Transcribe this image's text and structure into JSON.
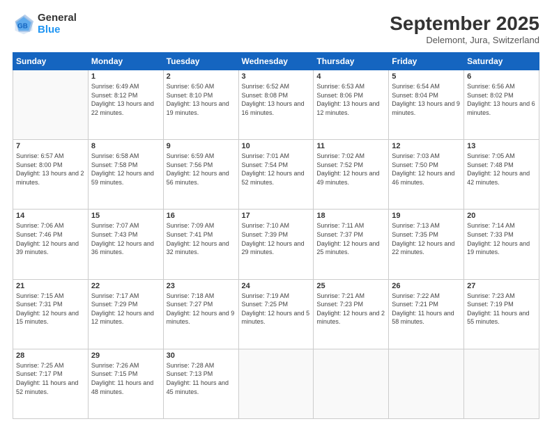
{
  "header": {
    "logo": {
      "general": "General",
      "blue": "Blue"
    },
    "title": "September 2025",
    "location": "Delemont, Jura, Switzerland"
  },
  "weekdays": [
    "Sunday",
    "Monday",
    "Tuesday",
    "Wednesday",
    "Thursday",
    "Friday",
    "Saturday"
  ],
  "weeks": [
    [
      {
        "day": "",
        "sunrise": "",
        "sunset": "",
        "daylight": ""
      },
      {
        "day": "1",
        "sunrise": "Sunrise: 6:49 AM",
        "sunset": "Sunset: 8:12 PM",
        "daylight": "Daylight: 13 hours and 22 minutes."
      },
      {
        "day": "2",
        "sunrise": "Sunrise: 6:50 AM",
        "sunset": "Sunset: 8:10 PM",
        "daylight": "Daylight: 13 hours and 19 minutes."
      },
      {
        "day": "3",
        "sunrise": "Sunrise: 6:52 AM",
        "sunset": "Sunset: 8:08 PM",
        "daylight": "Daylight: 13 hours and 16 minutes."
      },
      {
        "day": "4",
        "sunrise": "Sunrise: 6:53 AM",
        "sunset": "Sunset: 8:06 PM",
        "daylight": "Daylight: 13 hours and 12 minutes."
      },
      {
        "day": "5",
        "sunrise": "Sunrise: 6:54 AM",
        "sunset": "Sunset: 8:04 PM",
        "daylight": "Daylight: 13 hours and 9 minutes."
      },
      {
        "day": "6",
        "sunrise": "Sunrise: 6:56 AM",
        "sunset": "Sunset: 8:02 PM",
        "daylight": "Daylight: 13 hours and 6 minutes."
      }
    ],
    [
      {
        "day": "7",
        "sunrise": "Sunrise: 6:57 AM",
        "sunset": "Sunset: 8:00 PM",
        "daylight": "Daylight: 13 hours and 2 minutes."
      },
      {
        "day": "8",
        "sunrise": "Sunrise: 6:58 AM",
        "sunset": "Sunset: 7:58 PM",
        "daylight": "Daylight: 12 hours and 59 minutes."
      },
      {
        "day": "9",
        "sunrise": "Sunrise: 6:59 AM",
        "sunset": "Sunset: 7:56 PM",
        "daylight": "Daylight: 12 hours and 56 minutes."
      },
      {
        "day": "10",
        "sunrise": "Sunrise: 7:01 AM",
        "sunset": "Sunset: 7:54 PM",
        "daylight": "Daylight: 12 hours and 52 minutes."
      },
      {
        "day": "11",
        "sunrise": "Sunrise: 7:02 AM",
        "sunset": "Sunset: 7:52 PM",
        "daylight": "Daylight: 12 hours and 49 minutes."
      },
      {
        "day": "12",
        "sunrise": "Sunrise: 7:03 AM",
        "sunset": "Sunset: 7:50 PM",
        "daylight": "Daylight: 12 hours and 46 minutes."
      },
      {
        "day": "13",
        "sunrise": "Sunrise: 7:05 AM",
        "sunset": "Sunset: 7:48 PM",
        "daylight": "Daylight: 12 hours and 42 minutes."
      }
    ],
    [
      {
        "day": "14",
        "sunrise": "Sunrise: 7:06 AM",
        "sunset": "Sunset: 7:46 PM",
        "daylight": "Daylight: 12 hours and 39 minutes."
      },
      {
        "day": "15",
        "sunrise": "Sunrise: 7:07 AM",
        "sunset": "Sunset: 7:43 PM",
        "daylight": "Daylight: 12 hours and 36 minutes."
      },
      {
        "day": "16",
        "sunrise": "Sunrise: 7:09 AM",
        "sunset": "Sunset: 7:41 PM",
        "daylight": "Daylight: 12 hours and 32 minutes."
      },
      {
        "day": "17",
        "sunrise": "Sunrise: 7:10 AM",
        "sunset": "Sunset: 7:39 PM",
        "daylight": "Daylight: 12 hours and 29 minutes."
      },
      {
        "day": "18",
        "sunrise": "Sunrise: 7:11 AM",
        "sunset": "Sunset: 7:37 PM",
        "daylight": "Daylight: 12 hours and 25 minutes."
      },
      {
        "day": "19",
        "sunrise": "Sunrise: 7:13 AM",
        "sunset": "Sunset: 7:35 PM",
        "daylight": "Daylight: 12 hours and 22 minutes."
      },
      {
        "day": "20",
        "sunrise": "Sunrise: 7:14 AM",
        "sunset": "Sunset: 7:33 PM",
        "daylight": "Daylight: 12 hours and 19 minutes."
      }
    ],
    [
      {
        "day": "21",
        "sunrise": "Sunrise: 7:15 AM",
        "sunset": "Sunset: 7:31 PM",
        "daylight": "Daylight: 12 hours and 15 minutes."
      },
      {
        "day": "22",
        "sunrise": "Sunrise: 7:17 AM",
        "sunset": "Sunset: 7:29 PM",
        "daylight": "Daylight: 12 hours and 12 minutes."
      },
      {
        "day": "23",
        "sunrise": "Sunrise: 7:18 AM",
        "sunset": "Sunset: 7:27 PM",
        "daylight": "Daylight: 12 hours and 9 minutes."
      },
      {
        "day": "24",
        "sunrise": "Sunrise: 7:19 AM",
        "sunset": "Sunset: 7:25 PM",
        "daylight": "Daylight: 12 hours and 5 minutes."
      },
      {
        "day": "25",
        "sunrise": "Sunrise: 7:21 AM",
        "sunset": "Sunset: 7:23 PM",
        "daylight": "Daylight: 12 hours and 2 minutes."
      },
      {
        "day": "26",
        "sunrise": "Sunrise: 7:22 AM",
        "sunset": "Sunset: 7:21 PM",
        "daylight": "Daylight: 11 hours and 58 minutes."
      },
      {
        "day": "27",
        "sunrise": "Sunrise: 7:23 AM",
        "sunset": "Sunset: 7:19 PM",
        "daylight": "Daylight: 11 hours and 55 minutes."
      }
    ],
    [
      {
        "day": "28",
        "sunrise": "Sunrise: 7:25 AM",
        "sunset": "Sunset: 7:17 PM",
        "daylight": "Daylight: 11 hours and 52 minutes."
      },
      {
        "day": "29",
        "sunrise": "Sunrise: 7:26 AM",
        "sunset": "Sunset: 7:15 PM",
        "daylight": "Daylight: 11 hours and 48 minutes."
      },
      {
        "day": "30",
        "sunrise": "Sunrise: 7:28 AM",
        "sunset": "Sunset: 7:13 PM",
        "daylight": "Daylight: 11 hours and 45 minutes."
      },
      {
        "day": "",
        "sunrise": "",
        "sunset": "",
        "daylight": ""
      },
      {
        "day": "",
        "sunrise": "",
        "sunset": "",
        "daylight": ""
      },
      {
        "day": "",
        "sunrise": "",
        "sunset": "",
        "daylight": ""
      },
      {
        "day": "",
        "sunrise": "",
        "sunset": "",
        "daylight": ""
      }
    ]
  ]
}
